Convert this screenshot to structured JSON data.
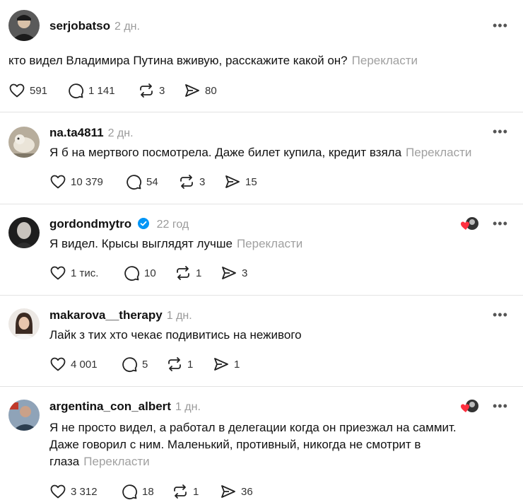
{
  "posts": [
    {
      "username": "serjobatso",
      "time": "2 дн.",
      "text": "кто видел Владимира Путина вживую, расскажите какой он?",
      "translate": "Перекласти",
      "likes": "591",
      "replies": "1 141",
      "reposts": "3",
      "shares": "80"
    },
    {
      "username": "na.ta4811",
      "time": "2 дн.",
      "text": "Я б на мертвого посмотрела. Даже билет купила, кредит взяла",
      "translate": "Перекласти",
      "likes": "10 379",
      "replies": "54",
      "reposts": "3",
      "shares": "15"
    },
    {
      "username": "gordondmytro",
      "time": "22 год",
      "text": "Я видел. Крысы выглядят лучше",
      "translate": "Перекласти",
      "likes": "1 тис.",
      "replies": "10",
      "reposts": "1",
      "shares": "3"
    },
    {
      "username": "makarova__therapy",
      "time": "1 дн.",
      "text": "Лайк з тих хто чекає подивитись на неживого",
      "likes": "4 001",
      "replies": "5",
      "reposts": "1",
      "shares": "1"
    },
    {
      "username": "argentina_con_albert",
      "time": "1 дн.",
      "text_lines": [
        "Я не просто видел, а работал в делегации когда он приезжал на саммит.",
        "Даже говорил с ним. Маленький, противный, никогда не смотрит в",
        "глаза"
      ],
      "translate": "Перекласти",
      "likes": "3 312",
      "replies": "18",
      "reposts": "1",
      "shares": "36"
    }
  ],
  "colors": {
    "muted": "#9a9a9a",
    "verified": "#0095f6",
    "heart": "#ff3040"
  }
}
